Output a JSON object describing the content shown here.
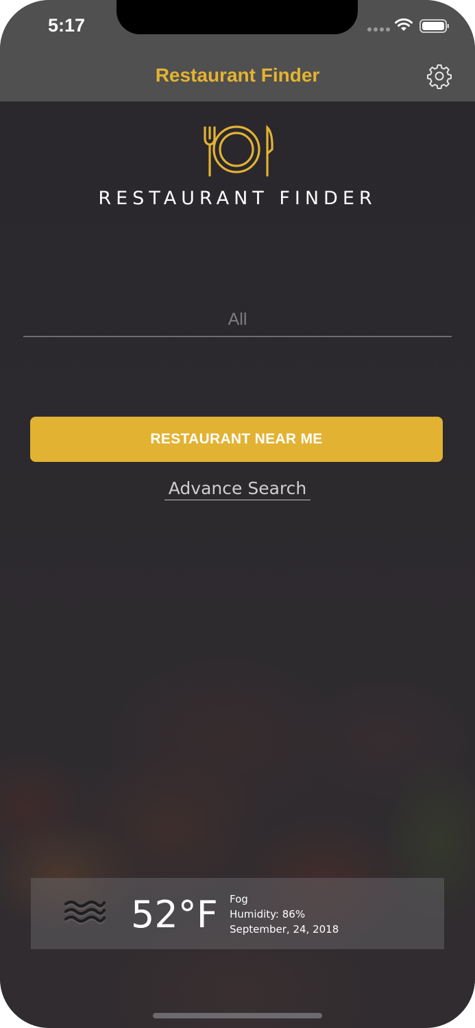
{
  "status_bar": {
    "time": "5:17"
  },
  "navbar": {
    "title": "Restaurant Finder",
    "settings_icon": "gear-icon"
  },
  "logo": {
    "icon": "fork-plate-knife-icon",
    "text": "RESTAURANT FINDER"
  },
  "search": {
    "placeholder": "All",
    "value": ""
  },
  "actions": {
    "primary_label": "RESTAURANT NEAR ME",
    "advance_search_label": "Advance Search"
  },
  "weather": {
    "icon": "fog-icon",
    "temperature": "52°F",
    "condition": "Fog",
    "humidity": "Humidity: 86%",
    "date": "September, 24, 2018"
  },
  "colors": {
    "accent": "#e2b233",
    "bar_background": "#505050",
    "screen_background": "#2b292e"
  }
}
